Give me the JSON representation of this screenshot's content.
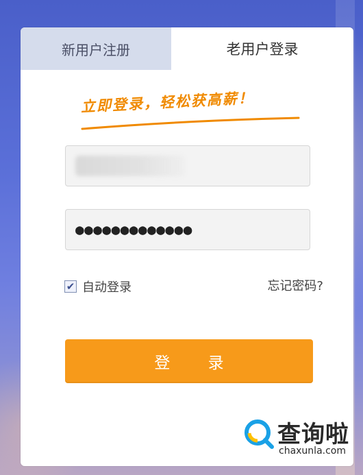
{
  "tabs": {
    "register_label": "新用户注册",
    "login_label": "老用户登录"
  },
  "slogan": "立即登录，轻松获高薪！",
  "username": {
    "value": ""
  },
  "password": {
    "masked": "●●●●●●●●●●●●●"
  },
  "remember": {
    "label": "自动登录",
    "checked": true
  },
  "forgot_label": "忘记密码?",
  "login_button_label": "登 录",
  "watermark": {
    "brand": "查询啦",
    "url": "chaxunla.com"
  },
  "colors": {
    "accent": "#f79a1a",
    "slogan": "#f08a00",
    "tab_inactive_bg": "#d5dcec"
  }
}
